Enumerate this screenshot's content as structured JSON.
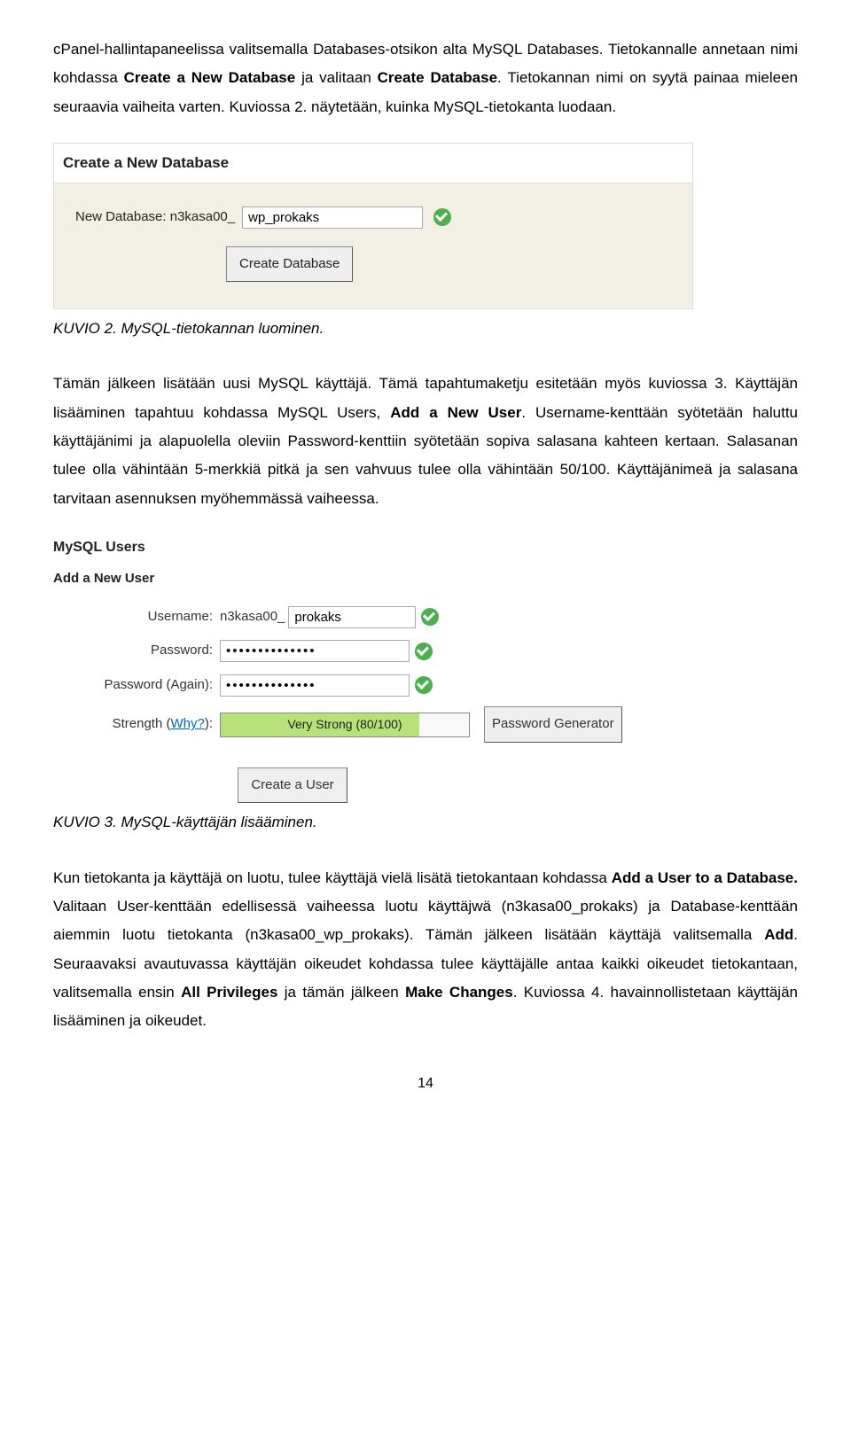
{
  "para1_a": "cPanel-hallintapaneelissa valitsemalla Databases-otsikon alta MySQL Databases. Tietokannalle annetaan nimi kohdassa ",
  "para1_b1": "Create a New Database",
  "para1_c": " ja valitaan ",
  "para1_b2": "Create Database",
  "para1_d": ". Tietokannan nimi on syytä painaa mieleen seuraavia vaiheita varten. Kuviossa 2. näytetään, kuinka MySQL-tietokanta luodaan.",
  "shot1": {
    "title": "Create a New Database",
    "label": "New Database: n3kasa00_",
    "value": "wp_prokaks",
    "button": "Create Database"
  },
  "caption1": "KUVIO 2. MySQL-tietokannan luominen.",
  "para2_a": "Tämän jälkeen lisätään uusi MySQL käyttäjä. Tämä tapahtumaketju esitetään myös kuviossa 3. Käyttäjän lisääminen tapahtuu kohdassa MySQL Users, ",
  "para2_b1": "Add a New User",
  "para2_c": ". Username-kenttään syötetään haluttu käyttäjänimi ja alapuolella oleviin Password-kenttiin syötetään sopiva salasana kahteen kertaan. Salasanan tulee olla vähintään 5-merkkiä pitkä ja sen vahvuus tulee olla vähintään 50/100. Käyttäjänimeä ja salasana tarvitaan asennuksen myöhemmässä vaiheessa.",
  "shot2": {
    "h1": "MySQL Users",
    "h2": "Add a New User",
    "username_label": "Username:",
    "username_prefix": "n3kasa00_",
    "username_value": "prokaks",
    "password_label": "Password:",
    "password_value": "••••••••••••••",
    "password_again_label": "Password (Again):",
    "password_again_value": "••••••••••••••",
    "strength_label_a": "Strength (",
    "strength_why": "Why?",
    "strength_label_b": "):",
    "strength_text": "Very Strong (80/100)",
    "generator_btn": "Password Generator",
    "create_btn": "Create a User"
  },
  "caption2": "KUVIO 3. MySQL-käyttäjän lisääminen.",
  "para3_a": "Kun tietokanta ja käyttäjä on luotu, tulee käyttäjä vielä lisätä tietokantaan kohdassa ",
  "para3_b1": "Add a User to a Database.",
  "para3_c": " Valitaan User-kenttään edellisessä vaiheessa luotu käyttäjwä (n3kasa00_prokaks) ja Database-kenttään aiemmin luotu tietokanta (n3kasa00_wp_prokaks). Tämän jälkeen lisätään käyttäjä valitsemalla ",
  "para3_b2": "Add",
  "para3_d": ". Seuraavaksi avautuvassa käyttäjän oikeudet kohdassa tulee käyttäjälle antaa kaikki oikeudet tietokantaan, valitsemalla ensin ",
  "para3_b3": "All Privileges",
  "para3_e": " ja tämän jälkeen ",
  "para3_b4": "Make Changes",
  "para3_f": ". Kuviossa 4. havainnollistetaan käyttäjän lisääminen ja oikeudet.",
  "page_num": "14"
}
